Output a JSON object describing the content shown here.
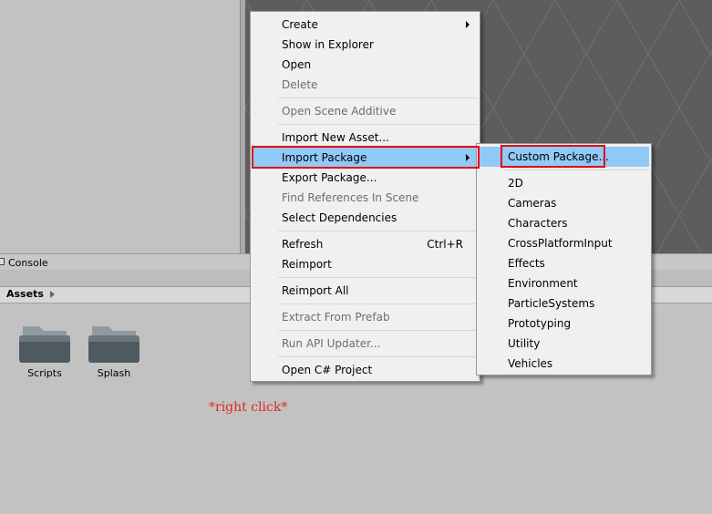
{
  "console": {
    "tab_label": "Console"
  },
  "assets": {
    "title": "Assets"
  },
  "folders": [
    {
      "label": "Scripts"
    },
    {
      "label": "Splash"
    }
  ],
  "annotation": "*right click*",
  "context_menu": {
    "items": [
      {
        "label": "Create",
        "submenu": true
      },
      {
        "label": "Show in Explorer"
      },
      {
        "label": "Open"
      },
      {
        "label": "Delete",
        "disabled": true
      },
      {
        "label": "Open Scene Additive",
        "disabled": true
      },
      {
        "label": "Import New Asset..."
      },
      {
        "label": "Import Package",
        "submenu": true,
        "highlighted": true
      },
      {
        "label": "Export Package..."
      },
      {
        "label": "Find References In Scene",
        "disabled": true
      },
      {
        "label": "Select Dependencies"
      },
      {
        "label": "Refresh",
        "shortcut": "Ctrl+R"
      },
      {
        "label": "Reimport"
      },
      {
        "label": "Reimport All"
      },
      {
        "label": "Extract From Prefab",
        "disabled": true
      },
      {
        "label": "Run API Updater...",
        "disabled": true
      },
      {
        "label": "Open C# Project"
      }
    ]
  },
  "import_submenu": {
    "items": [
      {
        "label": "Custom Package...",
        "highlighted": true
      },
      {
        "label": "2D"
      },
      {
        "label": "Cameras"
      },
      {
        "label": "Characters"
      },
      {
        "label": "CrossPlatformInput"
      },
      {
        "label": "Effects"
      },
      {
        "label": "Environment"
      },
      {
        "label": "ParticleSystems"
      },
      {
        "label": "Prototyping"
      },
      {
        "label": "Utility"
      },
      {
        "label": "Vehicles"
      }
    ]
  },
  "colors": {
    "highlight": "#91c9f7",
    "callout_border": "#e4000f",
    "annotation_text": "#e0271b"
  }
}
